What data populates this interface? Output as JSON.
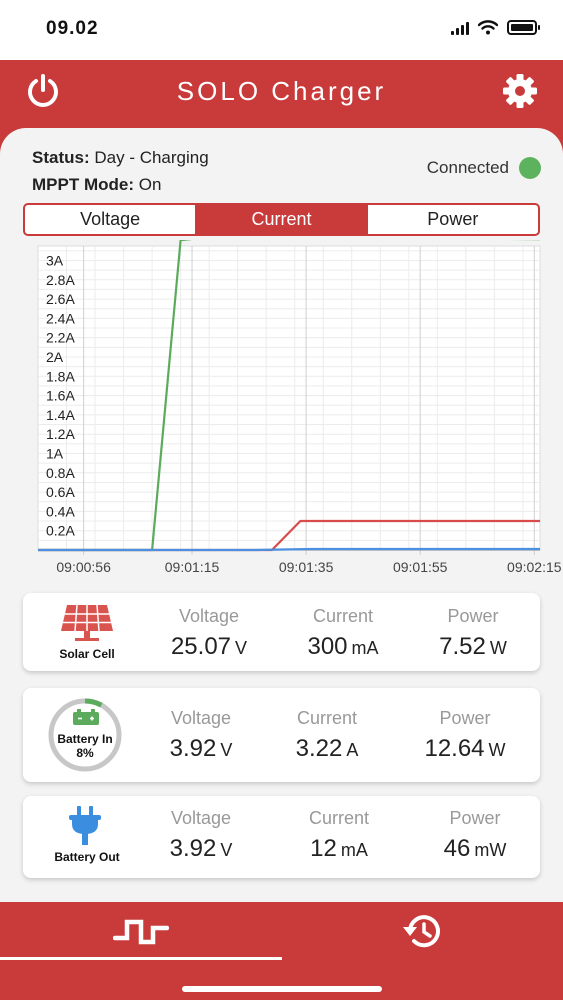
{
  "status_bar": {
    "time": "09.02"
  },
  "header": {
    "title": "SOLO Charger"
  },
  "status": {
    "status_label": "Status:",
    "status_value": "Day - Charging",
    "mppt_label": "MPPT Mode:",
    "mppt_value": "On",
    "connection": "Connected",
    "connection_color": "#5db35d"
  },
  "tabs": [
    {
      "label": "Voltage",
      "active": false
    },
    {
      "label": "Current",
      "active": true
    },
    {
      "label": "Power",
      "active": false
    }
  ],
  "chart_data": {
    "type": "line",
    "xlabel": "",
    "ylabel": "",
    "ylim": [
      0,
      3.15
    ],
    "y_ticks": [
      "3A",
      "2.8A",
      "2.6A",
      "2.4A",
      "2.2A",
      "2A",
      "1.8A",
      "1.6A",
      "1.4A",
      "1.2A",
      "1A",
      "0.8A",
      "0.6A",
      "0.4A",
      "0.2A"
    ],
    "y_tick_values": [
      3.0,
      2.8,
      2.6,
      2.4,
      2.2,
      2.0,
      1.8,
      1.6,
      1.4,
      1.2,
      1.0,
      0.8,
      0.6,
      0.4,
      0.2
    ],
    "x_ticks": [
      "09:00:56",
      "09:01:15",
      "09:01:35",
      "09:01:55",
      "09:02:15"
    ],
    "x_tick_values": [
      0,
      19,
      39,
      59,
      79
    ],
    "xlim": [
      -8,
      80
    ],
    "grid": true,
    "series": [
      {
        "color": "#5cab5c",
        "x": [
          -8,
          12,
          17,
          20,
          40,
          60,
          80
        ],
        "y": [
          0,
          0,
          3.21,
          3.23,
          3.23,
          3.23,
          3.22
        ]
      },
      {
        "color": "#d94a4a",
        "x": [
          -8,
          13,
          33,
          38,
          60,
          80
        ],
        "y": [
          0,
          0,
          0,
          0.3,
          0.3,
          0.3
        ]
      },
      {
        "color": "#4a8fe0",
        "x": [
          -8,
          30,
          40,
          60,
          80
        ],
        "y": [
          0,
          0,
          0.01,
          0.01,
          0.01
        ]
      }
    ]
  },
  "cards": [
    {
      "name": "Solar Cell",
      "icon": "solar-panel-icon",
      "metrics": [
        {
          "label": "Voltage",
          "value": "25.07",
          "unit": "V"
        },
        {
          "label": "Current",
          "value": "300",
          "unit": "mA"
        },
        {
          "label": "Power",
          "value": "7.52",
          "unit": "W"
        }
      ]
    },
    {
      "name": "Battery In",
      "percent": "8%",
      "level": 0.08,
      "icon": "battery-icon",
      "metrics": [
        {
          "label": "Voltage",
          "value": "3.92",
          "unit": "V"
        },
        {
          "label": "Current",
          "value": "3.22",
          "unit": "A"
        },
        {
          "label": "Power",
          "value": "12.64",
          "unit": "W"
        }
      ]
    },
    {
      "name": "Battery Out",
      "icon": "plug-icon",
      "metrics": [
        {
          "label": "Voltage",
          "value": "3.92",
          "unit": "V"
        },
        {
          "label": "Current",
          "value": "12",
          "unit": "mA"
        },
        {
          "label": "Power",
          "value": "46",
          "unit": "mW"
        }
      ]
    }
  ],
  "colors": {
    "accent": "#c93a3a",
    "background": "#f3f3f3",
    "card": "#ffffff"
  },
  "nav": {
    "items": [
      {
        "icon": "live-pulse-icon",
        "active": true
      },
      {
        "icon": "history-icon",
        "active": false
      }
    ]
  }
}
